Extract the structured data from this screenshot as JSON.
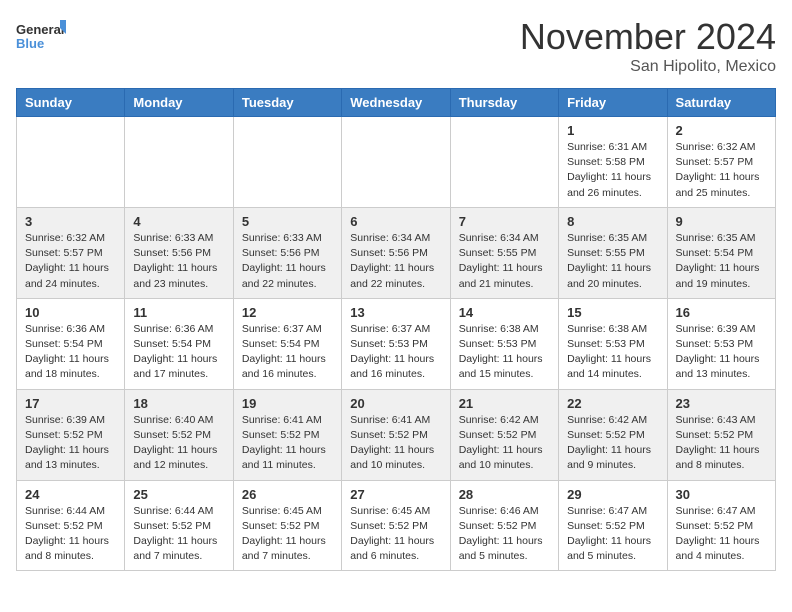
{
  "header": {
    "logo_general": "General",
    "logo_blue": "Blue",
    "month": "November 2024",
    "location": "San Hipolito, Mexico"
  },
  "days_of_week": [
    "Sunday",
    "Monday",
    "Tuesday",
    "Wednesday",
    "Thursday",
    "Friday",
    "Saturday"
  ],
  "weeks": [
    [
      {
        "day": "",
        "info": ""
      },
      {
        "day": "",
        "info": ""
      },
      {
        "day": "",
        "info": ""
      },
      {
        "day": "",
        "info": ""
      },
      {
        "day": "",
        "info": ""
      },
      {
        "day": "1",
        "info": "Sunrise: 6:31 AM\nSunset: 5:58 PM\nDaylight: 11 hours\nand 26 minutes."
      },
      {
        "day": "2",
        "info": "Sunrise: 6:32 AM\nSunset: 5:57 PM\nDaylight: 11 hours\nand 25 minutes."
      }
    ],
    [
      {
        "day": "3",
        "info": "Sunrise: 6:32 AM\nSunset: 5:57 PM\nDaylight: 11 hours\nand 24 minutes."
      },
      {
        "day": "4",
        "info": "Sunrise: 6:33 AM\nSunset: 5:56 PM\nDaylight: 11 hours\nand 23 minutes."
      },
      {
        "day": "5",
        "info": "Sunrise: 6:33 AM\nSunset: 5:56 PM\nDaylight: 11 hours\nand 22 minutes."
      },
      {
        "day": "6",
        "info": "Sunrise: 6:34 AM\nSunset: 5:56 PM\nDaylight: 11 hours\nand 22 minutes."
      },
      {
        "day": "7",
        "info": "Sunrise: 6:34 AM\nSunset: 5:55 PM\nDaylight: 11 hours\nand 21 minutes."
      },
      {
        "day": "8",
        "info": "Sunrise: 6:35 AM\nSunset: 5:55 PM\nDaylight: 11 hours\nand 20 minutes."
      },
      {
        "day": "9",
        "info": "Sunrise: 6:35 AM\nSunset: 5:54 PM\nDaylight: 11 hours\nand 19 minutes."
      }
    ],
    [
      {
        "day": "10",
        "info": "Sunrise: 6:36 AM\nSunset: 5:54 PM\nDaylight: 11 hours\nand 18 minutes."
      },
      {
        "day": "11",
        "info": "Sunrise: 6:36 AM\nSunset: 5:54 PM\nDaylight: 11 hours\nand 17 minutes."
      },
      {
        "day": "12",
        "info": "Sunrise: 6:37 AM\nSunset: 5:54 PM\nDaylight: 11 hours\nand 16 minutes."
      },
      {
        "day": "13",
        "info": "Sunrise: 6:37 AM\nSunset: 5:53 PM\nDaylight: 11 hours\nand 16 minutes."
      },
      {
        "day": "14",
        "info": "Sunrise: 6:38 AM\nSunset: 5:53 PM\nDaylight: 11 hours\nand 15 minutes."
      },
      {
        "day": "15",
        "info": "Sunrise: 6:38 AM\nSunset: 5:53 PM\nDaylight: 11 hours\nand 14 minutes."
      },
      {
        "day": "16",
        "info": "Sunrise: 6:39 AM\nSunset: 5:53 PM\nDaylight: 11 hours\nand 13 minutes."
      }
    ],
    [
      {
        "day": "17",
        "info": "Sunrise: 6:39 AM\nSunset: 5:52 PM\nDaylight: 11 hours\nand 13 minutes."
      },
      {
        "day": "18",
        "info": "Sunrise: 6:40 AM\nSunset: 5:52 PM\nDaylight: 11 hours\nand 12 minutes."
      },
      {
        "day": "19",
        "info": "Sunrise: 6:41 AM\nSunset: 5:52 PM\nDaylight: 11 hours\nand 11 minutes."
      },
      {
        "day": "20",
        "info": "Sunrise: 6:41 AM\nSunset: 5:52 PM\nDaylight: 11 hours\nand 10 minutes."
      },
      {
        "day": "21",
        "info": "Sunrise: 6:42 AM\nSunset: 5:52 PM\nDaylight: 11 hours\nand 10 minutes."
      },
      {
        "day": "22",
        "info": "Sunrise: 6:42 AM\nSunset: 5:52 PM\nDaylight: 11 hours\nand 9 minutes."
      },
      {
        "day": "23",
        "info": "Sunrise: 6:43 AM\nSunset: 5:52 PM\nDaylight: 11 hours\nand 8 minutes."
      }
    ],
    [
      {
        "day": "24",
        "info": "Sunrise: 6:44 AM\nSunset: 5:52 PM\nDaylight: 11 hours\nand 8 minutes."
      },
      {
        "day": "25",
        "info": "Sunrise: 6:44 AM\nSunset: 5:52 PM\nDaylight: 11 hours\nand 7 minutes."
      },
      {
        "day": "26",
        "info": "Sunrise: 6:45 AM\nSunset: 5:52 PM\nDaylight: 11 hours\nand 7 minutes."
      },
      {
        "day": "27",
        "info": "Sunrise: 6:45 AM\nSunset: 5:52 PM\nDaylight: 11 hours\nand 6 minutes."
      },
      {
        "day": "28",
        "info": "Sunrise: 6:46 AM\nSunset: 5:52 PM\nDaylight: 11 hours\nand 5 minutes."
      },
      {
        "day": "29",
        "info": "Sunrise: 6:47 AM\nSunset: 5:52 PM\nDaylight: 11 hours\nand 5 minutes."
      },
      {
        "day": "30",
        "info": "Sunrise: 6:47 AM\nSunset: 5:52 PM\nDaylight: 11 hours\nand 4 minutes."
      }
    ]
  ]
}
